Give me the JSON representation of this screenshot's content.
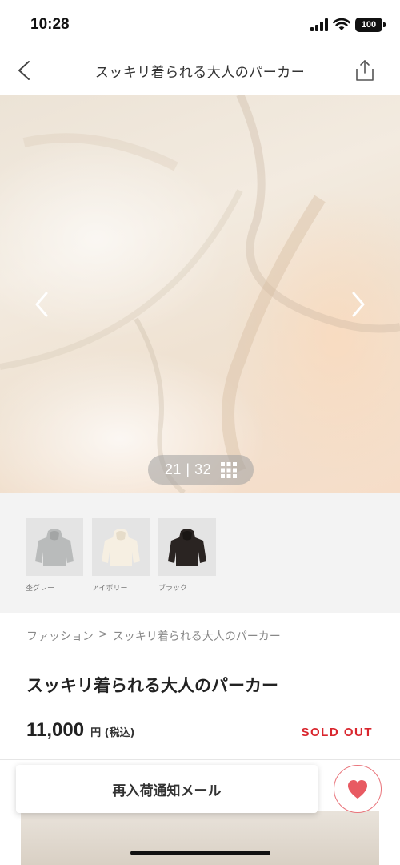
{
  "status_bar": {
    "time": "10:28",
    "battery": "100",
    "icons": [
      "signal-icon",
      "wifi-icon",
      "battery-icon"
    ]
  },
  "header": {
    "title": "スッキリ着られる大人のパーカー",
    "back_icon": "chevron-left-icon",
    "share_icon": "share-icon"
  },
  "gallery": {
    "current": "21",
    "total": "32",
    "separator": "|",
    "grid_icon": "grid-icon",
    "prev_icon": "chevron-left-icon",
    "next_icon": "chevron-right-icon"
  },
  "colors": [
    {
      "label": "杢グレー",
      "swatch": "#b9bbbb"
    },
    {
      "label": "アイボリー",
      "swatch": "#efe7d8"
    },
    {
      "label": "ブラック",
      "swatch": "#2a2422"
    }
  ],
  "breadcrumb": {
    "root": "ファッション",
    "separator": ">",
    "current": "スッキリ着られる大人のパーカー"
  },
  "product": {
    "title": "スッキリ着られる大人のパーカー",
    "price": "11,000",
    "price_unit": "円 (税込)",
    "status": "SOLD OUT"
  },
  "actions": {
    "restock_label": "再入荷通知メール",
    "favorite_icon": "heart-icon"
  },
  "theme": {
    "accent_red": "#d9262e",
    "heart_pink": "#e9737a"
  }
}
